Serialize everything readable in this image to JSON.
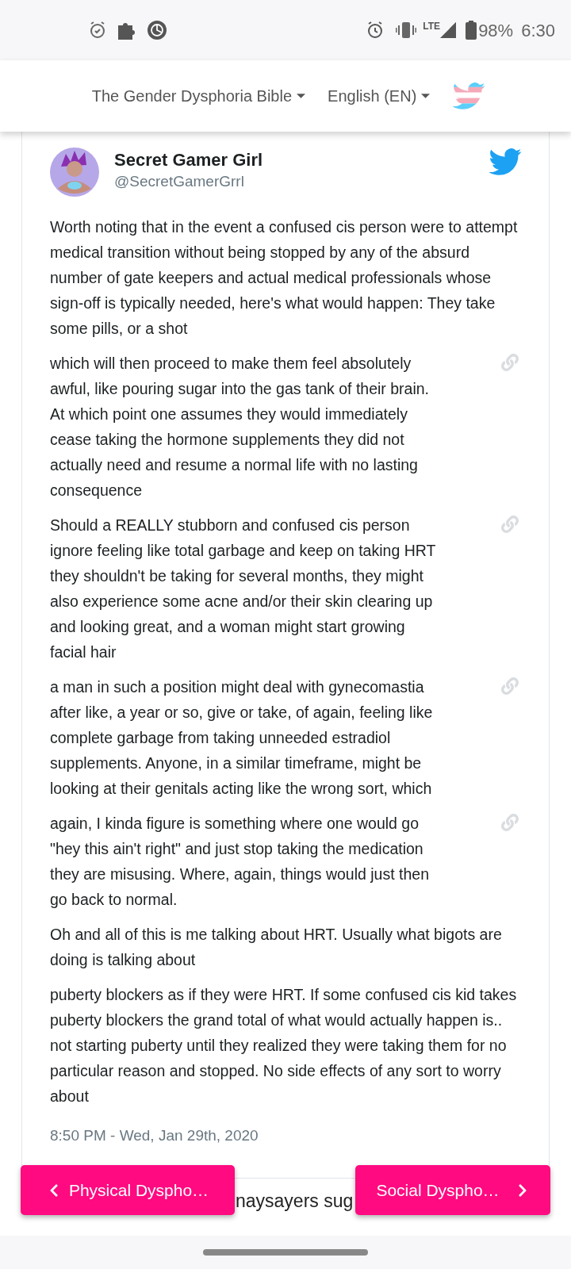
{
  "status_bar": {
    "network": "LTE",
    "battery": "98%",
    "time": "6:30"
  },
  "header": {
    "menus": [
      {
        "label": "The Gender Dysphoria Bible"
      },
      {
        "label": "English (EN)"
      }
    ]
  },
  "tweet": {
    "author": "Secret Gamer Girl",
    "handle": "@SecretGamerGrrl",
    "paragraphs": [
      {
        "text": "Worth noting that in the event a confused cis person were to attempt medical transition without being stopped by any of the absurd number of gate keepers and actual medical professionals whose sign-off is typically needed, here's what would happen: They take some pills, or a shot",
        "linked": false
      },
      {
        "text": "which will then proceed to make them feel absolutely awful, like pouring sugar into the gas tank of their brain. At which point one assumes they would immediately cease taking the hormone supplements they did not actually need and resume a normal life with no lasting consequence",
        "linked": true
      },
      {
        "text": "Should a REALLY stubborn and confused cis person ignore feeling like total garbage and keep on taking HRT they shouldn't be taking for several months, they might also experience some acne and/or their skin clearing up and looking great, and a woman might start growing facial hair",
        "linked": true
      },
      {
        "text": "a man in such a position might deal with gynecomastia after like, a year or so, give or take, of again, feeling like complete garbage from taking unneeded estradiol supplements. Anyone, in a similar timeframe, might be looking at their genitals acting like the wrong sort, which",
        "linked": true
      },
      {
        "text": "again, I kinda figure is something where one would go \"hey this ain't right\" and just stop taking the medication they are misusing. Where, again, things would just then go back to normal.",
        "linked": true
      },
      {
        "text": "Oh and all of this is me talking about HRT. Usually what bigots are doing is talking about",
        "linked": false
      },
      {
        "text": "puberty blockers as if they were HRT. If some confused cis kid takes puberty blockers the grand total of what would actually happen is.. not starting puberty until they realized they were taking them for no particular reason and stopped. No side effects of any sort to worry about",
        "linked": false
      }
    ],
    "timestamp": "8:50 PM - Wed, Jan 29th, 2020"
  },
  "article_text": "naysayers sug",
  "nav": {
    "previous": "Physical Dyspho…",
    "next": "Social Dyspho…"
  }
}
